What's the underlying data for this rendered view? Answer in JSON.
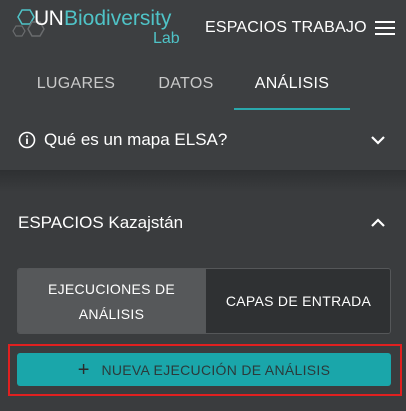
{
  "header": {
    "logo_un": "UN",
    "logo_biodiversity": "Biodiversity",
    "logo_lab": "Lab",
    "workspaces_label": "ESPACIOS TRABAJO",
    "menu_icon": "hamburger-icon"
  },
  "tabs": [
    {
      "label": "LUGARES",
      "active": false
    },
    {
      "label": "DATOS",
      "active": false
    },
    {
      "label": "ANÁLISIS",
      "active": true
    }
  ],
  "info": {
    "label": "Qué es un mapa ELSA?",
    "icon": "info-icon",
    "expand_icon": "chevron-down-icon"
  },
  "section": {
    "title": "ESPACIOS Kazajstán",
    "collapse_icon": "chevron-up-icon",
    "segments": {
      "executions_line1": "EJECUCIONES DE",
      "executions_line2": "ANÁLISIS",
      "input_layers": "CAPAS DE ENTRADA"
    },
    "new_button": {
      "icon": "plus-icon",
      "label": "NUEVA EJECUCIÓN DE ANÁLISIS"
    }
  },
  "colors": {
    "accent": "#1aa6aa",
    "highlight_border": "#e02020",
    "background": "#3a3c3e"
  }
}
